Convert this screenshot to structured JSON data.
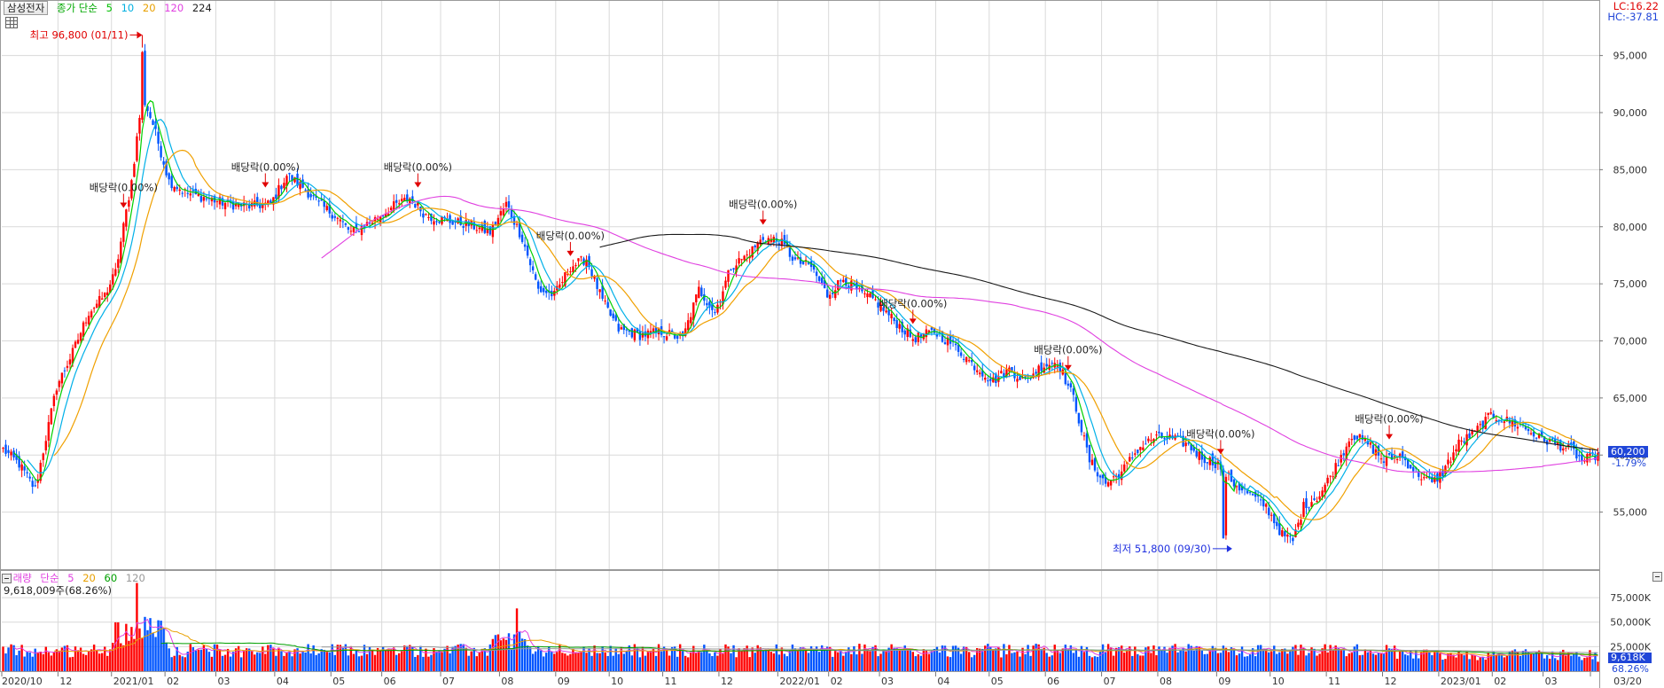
{
  "header": {
    "stock_name": "삼성전자",
    "ma_title": "종가 단순",
    "ma_periods": [
      {
        "label": "5",
        "color": "#00c000"
      },
      {
        "label": "10",
        "color": "#00b0e0"
      },
      {
        "label": "20",
        "color": "#e8a000"
      },
      {
        "label": "120",
        "color": "#e040e0"
      },
      {
        "label": "224",
        "color": "#222222"
      }
    ],
    "lc": "LC:16.22",
    "hc": "HC:-37.81"
  },
  "volume_header": {
    "title": "거래량",
    "ma_title": "단순",
    "ma_periods": [
      {
        "label": "5",
        "color": "#e040e0"
      },
      {
        "label": "20",
        "color": "#e8a000"
      },
      {
        "label": "60",
        "color": "#00a000"
      },
      {
        "label": "120",
        "color": "#999999"
      }
    ],
    "current": "9,618,009주(68.26%)"
  },
  "right_labels": {
    "price": "60,200",
    "change": "-1.79%",
    "volume": "9,618K",
    "volume_pct": "68.26%"
  },
  "colors": {
    "up": "#ff0000",
    "down": "#0055ff",
    "grid": "#d9d9d9",
    "axis_bg": "#ffffff"
  },
  "chart_data": {
    "type": "candlestick",
    "price_axis": {
      "min": 50000,
      "max": 98000,
      "ticks": [
        55000,
        60000,
        65000,
        70000,
        75000,
        80000,
        85000,
        90000,
        95000
      ],
      "tick_labels": [
        "55,000",
        "60,000",
        "65,000",
        "70,000",
        "75,000",
        "80,000",
        "85,000",
        "90,000",
        "95,000"
      ]
    },
    "volume_axis": {
      "max": 95000,
      "ticks": [
        25000,
        50000,
        75000
      ],
      "tick_labels": [
        "25,000K",
        "50,000K",
        "75,000K"
      ]
    },
    "x_labels": [
      {
        "i": 0,
        "label": "2020/10"
      },
      {
        "i": 21,
        "label": "12"
      },
      {
        "i": 41,
        "label": "2021/01"
      },
      {
        "i": 61,
        "label": "02"
      },
      {
        "i": 80,
        "label": "03"
      },
      {
        "i": 102,
        "label": "04"
      },
      {
        "i": 123,
        "label": "05"
      },
      {
        "i": 142,
        "label": "06"
      },
      {
        "i": 164,
        "label": "07"
      },
      {
        "i": 186,
        "label": "08"
      },
      {
        "i": 207,
        "label": "09"
      },
      {
        "i": 227,
        "label": "10"
      },
      {
        "i": 247,
        "label": "11"
      },
      {
        "i": 268,
        "label": "12"
      },
      {
        "i": 290,
        "label": "2022/01"
      },
      {
        "i": 309,
        "label": "02"
      },
      {
        "i": 328,
        "label": "03"
      },
      {
        "i": 349,
        "label": "04"
      },
      {
        "i": 369,
        "label": "05"
      },
      {
        "i": 390,
        "label": "06"
      },
      {
        "i": 411,
        "label": "07"
      },
      {
        "i": 432,
        "label": "08"
      },
      {
        "i": 454,
        "label": "09"
      },
      {
        "i": 474,
        "label": "10"
      },
      {
        "i": 495,
        "label": "11"
      },
      {
        "i": 516,
        "label": "12"
      },
      {
        "i": 537,
        "label": "2023/01"
      },
      {
        "i": 557,
        "label": "02"
      },
      {
        "i": 576,
        "label": "03"
      },
      {
        "i": 598,
        "label": "03/20"
      }
    ],
    "anchors": [
      [
        0,
        60500
      ],
      [
        6,
        59200
      ],
      [
        12,
        57000
      ],
      [
        20,
        66000
      ],
      [
        26,
        69000
      ],
      [
        32,
        72500
      ],
      [
        38,
        74000
      ],
      [
        42,
        76000
      ],
      [
        48,
        84000
      ],
      [
        52,
        91500
      ],
      [
        56,
        89000
      ],
      [
        62,
        84000
      ],
      [
        68,
        83000
      ],
      [
        76,
        82500
      ],
      [
        84,
        82000
      ],
      [
        92,
        81800
      ],
      [
        100,
        82000
      ],
      [
        106,
        84500
      ],
      [
        112,
        83500
      ],
      [
        118,
        82000
      ],
      [
        124,
        81000
      ],
      [
        130,
        79500
      ],
      [
        138,
        80500
      ],
      [
        146,
        81800
      ],
      [
        152,
        82500
      ],
      [
        158,
        81000
      ],
      [
        166,
        80500
      ],
      [
        174,
        80200
      ],
      [
        182,
        79500
      ],
      [
        188,
        82000
      ],
      [
        194,
        79000
      ],
      [
        200,
        74500
      ],
      [
        206,
        74000
      ],
      [
        212,
        76500
      ],
      [
        218,
        77200
      ],
      [
        224,
        73500
      ],
      [
        230,
        71000
      ],
      [
        238,
        70500
      ],
      [
        246,
        70800
      ],
      [
        254,
        70200
      ],
      [
        260,
        74500
      ],
      [
        266,
        72500
      ],
      [
        272,
        76500
      ],
      [
        278,
        77500
      ],
      [
        284,
        79000
      ],
      [
        290,
        78800
      ],
      [
        296,
        77000
      ],
      [
        302,
        76500
      ],
      [
        308,
        74000
      ],
      [
        314,
        75500
      ],
      [
        320,
        74200
      ],
      [
        326,
        73500
      ],
      [
        332,
        72000
      ],
      [
        340,
        70200
      ],
      [
        348,
        70800
      ],
      [
        356,
        69500
      ],
      [
        362,
        68000
      ],
      [
        370,
        66500
      ],
      [
        376,
        67500
      ],
      [
        382,
        66500
      ],
      [
        388,
        67800
      ],
      [
        394,
        68200
      ],
      [
        400,
        65000
      ],
      [
        406,
        59500
      ],
      [
        412,
        57500
      ],
      [
        418,
        58500
      ],
      [
        424,
        60500
      ],
      [
        430,
        61500
      ],
      [
        436,
        61500
      ],
      [
        442,
        61000
      ],
      [
        448,
        59800
      ],
      [
        454,
        59200
      ],
      [
        460,
        57500
      ],
      [
        466,
        56500
      ],
      [
        472,
        55500
      ],
      [
        478,
        53000
      ],
      [
        482,
        52500
      ],
      [
        486,
        55500
      ],
      [
        492,
        56500
      ],
      [
        498,
        59000
      ],
      [
        504,
        61800
      ],
      [
        510,
        61000
      ],
      [
        516,
        59500
      ],
      [
        522,
        60000
      ],
      [
        528,
        58500
      ],
      [
        534,
        57500
      ],
      [
        538,
        58500
      ],
      [
        544,
        61000
      ],
      [
        550,
        62000
      ],
      [
        556,
        63500
      ],
      [
        562,
        63000
      ],
      [
        568,
        62500
      ],
      [
        574,
        61500
      ],
      [
        580,
        61000
      ],
      [
        586,
        60500
      ],
      [
        590,
        59500
      ],
      [
        594,
        59800
      ],
      [
        596,
        60200
      ]
    ],
    "n_bars": 597,
    "last_close": 60200,
    "ma_lines": [
      {
        "name": "5",
        "period": 5,
        "color": "#00d000"
      },
      {
        "name": "10",
        "period": 10,
        "color": "#00b0e8"
      },
      {
        "name": "20",
        "period": 20,
        "color": "#f0a000"
      },
      {
        "name": "120",
        "period": 120,
        "color": "#e040e0"
      },
      {
        "name": "224",
        "period": 224,
        "color": "#1a1a1a"
      }
    ],
    "annotations": [
      {
        "i": 45,
        "text": "배당락(0.00%)",
        "kind": "dividend"
      },
      {
        "i": 98,
        "text": "배당락(0.00%)",
        "kind": "dividend"
      },
      {
        "i": 155,
        "text": "배당락(0.00%)",
        "kind": "dividend"
      },
      {
        "i": 212,
        "text": "배당락(0.00%)",
        "kind": "dividend"
      },
      {
        "i": 284,
        "text": "배당락(0.00%)",
        "kind": "dividend"
      },
      {
        "i": 340,
        "text": "배당락(0.00%)",
        "kind": "dividend"
      },
      {
        "i": 398,
        "text": "배당락(0.00%)",
        "kind": "dividend"
      },
      {
        "i": 455,
        "text": "배당락(0.00%)",
        "kind": "dividend"
      },
      {
        "i": 518,
        "text": "배당락(0.00%)",
        "kind": "dividend"
      }
    ],
    "high": {
      "i": 52,
      "value": 96800,
      "label": "최고 96,800 (01/11)"
    },
    "low": {
      "i": 456,
      "value": 51800,
      "label": "최저 51,800 (09/30)"
    }
  }
}
